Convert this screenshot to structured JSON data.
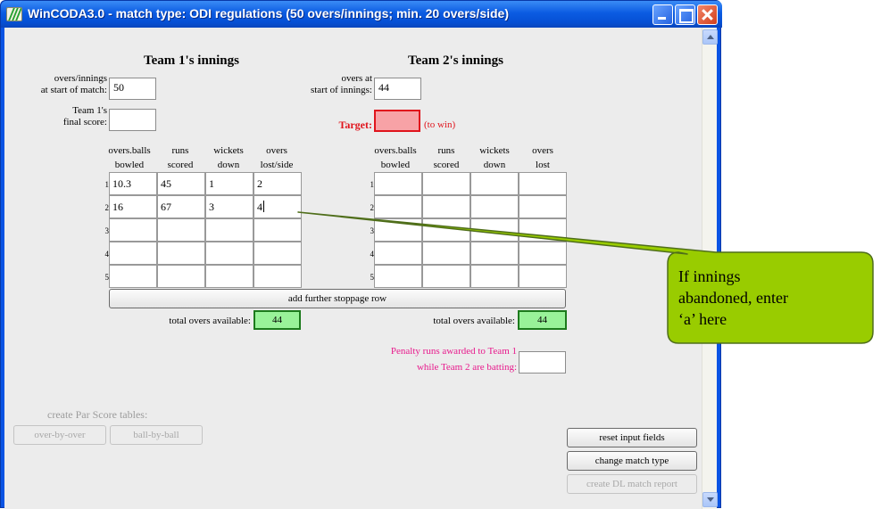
{
  "window": {
    "title": "WinCODA3.0 - match type: ODI regulations (50 overs/innings; min. 20 overs/side)"
  },
  "team1": {
    "heading": "Team 1's innings",
    "overs_label_1": "overs/innings",
    "overs_label_2": "at start of match:",
    "overs_value": "50",
    "final_label_1": "Team 1's",
    "final_label_2": "final score:",
    "final_value": "",
    "columns": [
      {
        "l1": "overs.balls",
        "l2": "bowled"
      },
      {
        "l1": "runs",
        "l2": "scored"
      },
      {
        "l1": "wickets",
        "l2": "down"
      },
      {
        "l1": "overs",
        "l2": "lost/side"
      }
    ],
    "rows": [
      {
        "num": "1",
        "cells": [
          "10.3",
          "45",
          "1",
          "2"
        ]
      },
      {
        "num": "2",
        "cells": [
          "16",
          "67",
          "3",
          "4"
        ]
      },
      {
        "num": "3",
        "cells": [
          "",
          "",
          "",
          ""
        ]
      },
      {
        "num": "4",
        "cells": [
          "",
          "",
          "",
          ""
        ]
      },
      {
        "num": "5",
        "cells": [
          "",
          "",
          "",
          ""
        ]
      }
    ],
    "total_label": "total overs available:",
    "total_value": "44"
  },
  "team2": {
    "heading": "Team 2's innings",
    "overs_label_1": "overs at",
    "overs_label_2": "start of innings:",
    "overs_value": "44",
    "target_label": "Target:",
    "target_value": "",
    "target_suffix": "(to win)",
    "columns": [
      {
        "l1": "overs.balls",
        "l2": "bowled"
      },
      {
        "l1": "runs",
        "l2": "scored"
      },
      {
        "l1": "wickets",
        "l2": "down"
      },
      {
        "l1": "overs",
        "l2": "lost"
      }
    ],
    "rows": [
      {
        "num": "1",
        "cells": [
          "",
          "",
          "",
          ""
        ]
      },
      {
        "num": "2",
        "cells": [
          "",
          "",
          "",
          ""
        ]
      },
      {
        "num": "3",
        "cells": [
          "",
          "",
          "",
          ""
        ]
      },
      {
        "num": "4",
        "cells": [
          "",
          "",
          "",
          ""
        ]
      },
      {
        "num": "5",
        "cells": [
          "",
          "",
          "",
          ""
        ]
      }
    ],
    "total_label": "total overs available:",
    "total_value": "44"
  },
  "add_row_button": "add further stoppage row",
  "penalty": {
    "label_1": "Penalty runs awarded to Team 1",
    "label_2": "while Team 2 are batting:",
    "value": ""
  },
  "par": {
    "label": "create Par Score tables:",
    "over_by_over": "over-by-over",
    "ball_by_ball": "ball-by-ball"
  },
  "actions": {
    "reset": "reset input fields",
    "change_type": "change match type",
    "report": "create DL match report"
  },
  "callout": {
    "lines": [
      "If innings",
      "abandoned, enter",
      "‘a’ here"
    ]
  },
  "colors": {
    "titlebar": "#0b5be2",
    "target_fill": "#f7a2a6",
    "target_text": "#e0141c",
    "total_fill": "#99f299",
    "penalty_text": "#e8198c",
    "callout_fill": "#99cc00"
  }
}
